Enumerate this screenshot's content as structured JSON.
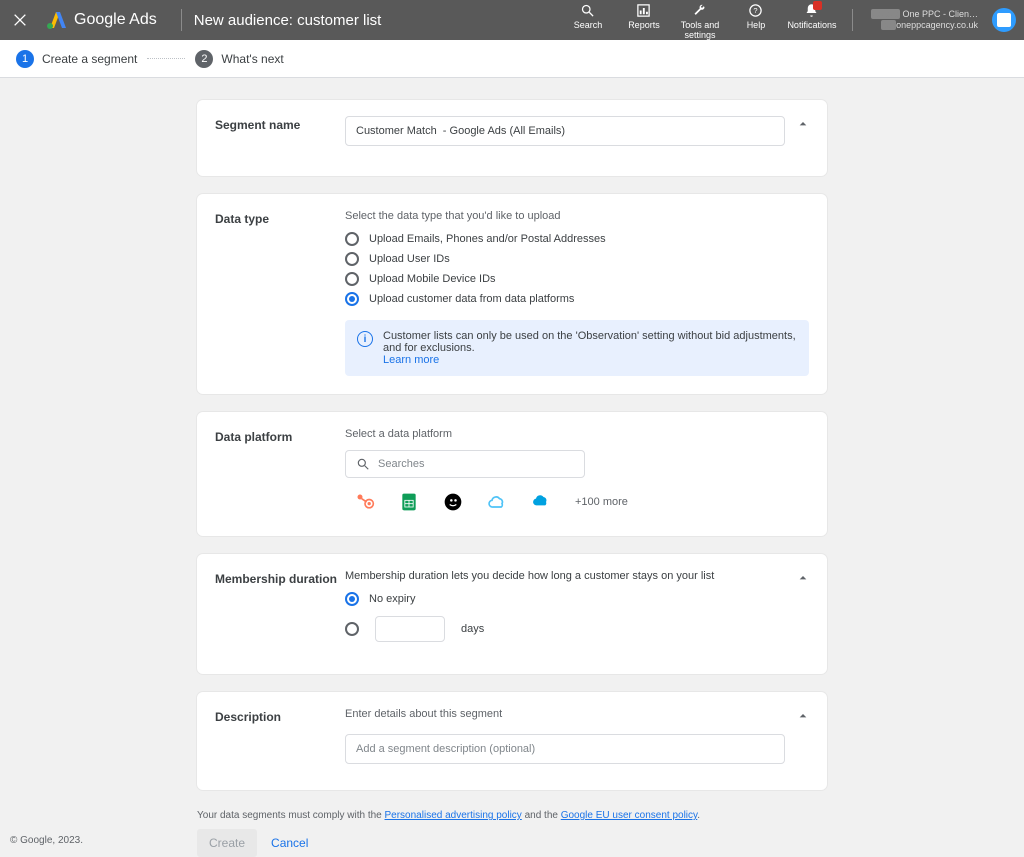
{
  "header": {
    "brand": "Google Ads",
    "page_title": "New audience: customer list",
    "icons": {
      "search": "Search",
      "reports": "Reports",
      "tools": "Tools and settings",
      "help": "Help",
      "notifications": "Notifications"
    },
    "account": {
      "line1": "One PPC - Clien…",
      "line2": "oneppcagency.co.uk"
    }
  },
  "stepper": {
    "step1": "Create a segment",
    "step2": "What's next"
  },
  "segment_name": {
    "label": "Segment name",
    "value": "Customer Match  - Google Ads (All Emails)"
  },
  "data_type": {
    "label": "Data type",
    "help": "Select the data type that you'd like to upload",
    "options": [
      "Upload Emails, Phones and/or Postal Addresses",
      "Upload User IDs",
      "Upload Mobile Device IDs",
      "Upload customer data from data platforms"
    ],
    "info_text": "Customer lists can only be used on the 'Observation' setting without bid adjustments, and for exclusions.",
    "info_link": "Learn more"
  },
  "data_platform": {
    "label": "Data platform",
    "help": "Select a data platform",
    "search_placeholder": "Searches",
    "more": "+100 more"
  },
  "membership": {
    "label": "Membership duration",
    "help": "Membership duration lets you decide how long a customer stays on your list",
    "no_expiry": "No expiry",
    "days_suffix": "days"
  },
  "description": {
    "label": "Description",
    "help": "Enter details about this segment",
    "placeholder": "Add a segment description (optional)"
  },
  "policy": {
    "prefix": "Your data segments must comply with the ",
    "link1": "Personalised advertising policy",
    "mid": " and the ",
    "link2": "Google EU user consent policy"
  },
  "actions": {
    "create": "Create",
    "cancel": "Cancel"
  },
  "copyright": "© Google, 2023."
}
